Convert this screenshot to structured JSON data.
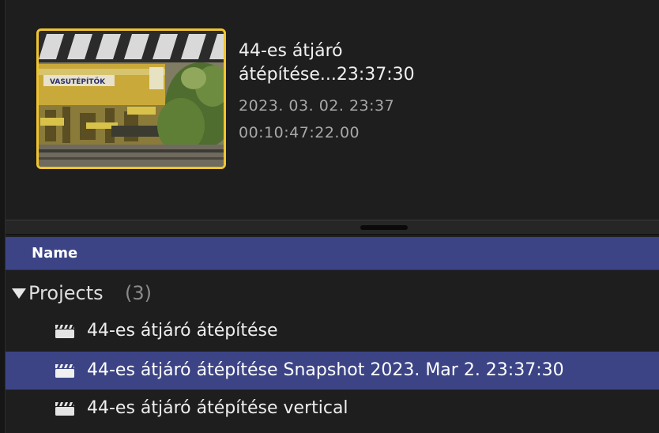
{
  "preview": {
    "title_line1": "44-es átjáró",
    "title_line2": "átépítése...23:37:30",
    "date": "2023. 03. 02. 23:37",
    "duration": "00:10:47:22.00",
    "thumbnail_text": "VASUTÉPÍTŐK"
  },
  "list": {
    "column_name": "Name",
    "group": {
      "label": "Projects",
      "count": "(3)"
    },
    "rows": [
      {
        "label": "44-es átjáró átépítése",
        "icon": "clapperboard-icon",
        "selected": false
      },
      {
        "label": "44-es átjáró átépítése Snapshot 2023. Mar 2. 23:37:30",
        "icon": "clapperboard-icon",
        "selected": true
      },
      {
        "label": "44-es átjáró átépítése vertical",
        "icon": "clapperboard-icon",
        "selected": false
      }
    ]
  },
  "colors": {
    "background": "#1e1e1e",
    "selection": "#3c4486",
    "thumbnail_border": "#f1c431"
  }
}
